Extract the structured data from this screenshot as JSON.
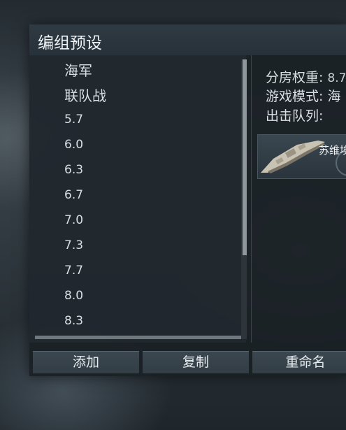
{
  "window": {
    "title": "编组预设"
  },
  "list": {
    "items": [
      {
        "label": "海军"
      },
      {
        "label": "联队战"
      },
      {
        "label": "5.7"
      },
      {
        "label": "6.0"
      },
      {
        "label": "6.3"
      },
      {
        "label": "6.7"
      },
      {
        "label": "7.0"
      },
      {
        "label": "7.3"
      },
      {
        "label": "7.7"
      },
      {
        "label": "8.0"
      },
      {
        "label": "8.3"
      }
    ]
  },
  "info": {
    "br_label": "分房权重:",
    "br_value": "8.7",
    "mode_label": "游戏模式:",
    "mode_value": "海",
    "lineup_label": "出击队列:"
  },
  "ship_card": {
    "name": "苏维埃"
  },
  "buttons": {
    "add": "添加",
    "copy": "复制",
    "rename": "重命名"
  },
  "colors": {
    "panel_bg": "#1a2025",
    "titlebar_bg": "#2f3a42",
    "text": "#d9dfe3",
    "button_bg": "#3b4750"
  }
}
